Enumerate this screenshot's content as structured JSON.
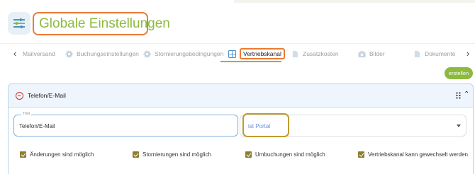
{
  "header": {
    "title": "Globale Einstellungen",
    "app_icon": "sliders-icon",
    "title_color": "#8cba3d",
    "highlight_color": "#ec7a33"
  },
  "tabs": {
    "prev_icon": "chevron-left-icon",
    "next_icon": "chevron-right-icon",
    "items": [
      {
        "label": "Mailversand",
        "icon": "mail-icon"
      },
      {
        "label": "Buchungseinstellungen",
        "icon": "gear-icon"
      },
      {
        "label": "Stornierungsbedingungen",
        "icon": "gear-icon"
      },
      {
        "label": "Vertriebskanal",
        "icon": "grid-icon",
        "active": true
      },
      {
        "label": "Zusatzkosten",
        "icon": "document-icon"
      },
      {
        "label": "Bilder",
        "icon": "camera-icon"
      },
      {
        "label": "Dokumente",
        "icon": "document-icon"
      }
    ]
  },
  "actions": {
    "create_label": "erstellen"
  },
  "panel": {
    "title": "Telefon/E-Mail",
    "remove_icon": "minus-circle-icon",
    "drag_icon": "drag-handle-icon",
    "collapse_icon": "chevron-up-icon"
  },
  "form": {
    "title_field": {
      "legend": "Titel",
      "value": "Telefon/E-Mail"
    },
    "portal_select": {
      "placeholder": "ist Portal"
    }
  },
  "options": [
    {
      "label": "Änderungen sind möglich",
      "checked": true
    },
    {
      "label": "Stornierungen sind möglich",
      "checked": true
    },
    {
      "label": "Umbuchungen sind möglich",
      "checked": true
    },
    {
      "label": "Vertriebskanal kann gewechselt werden",
      "checked": true
    }
  ],
  "colors": {
    "accent": "#8cba3d",
    "annotation": "#ec7a33",
    "checkbox": "#8d7d2f",
    "panel_header": "#eef5fc"
  }
}
